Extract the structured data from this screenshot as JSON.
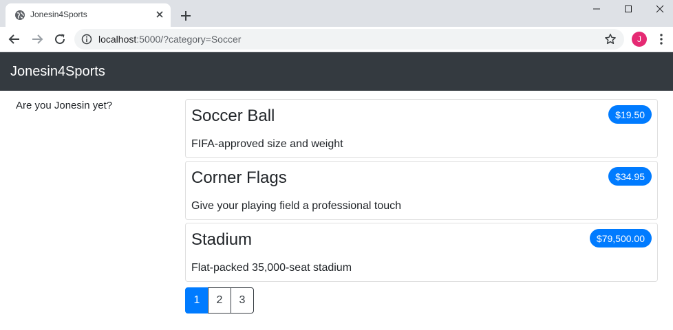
{
  "browser": {
    "tab_title": "Jonesin4Sports",
    "url_host": "localhost",
    "url_path": ":5000/?category=Soccer",
    "profile_initial": "J"
  },
  "navbar": {
    "brand": "Jonesin4Sports"
  },
  "sidebar": {
    "text": "Are you Jonesin yet?"
  },
  "products": [
    {
      "name": "Soccer Ball",
      "price": "$19.50",
      "description": "FIFA-approved size and weight"
    },
    {
      "name": "Corner Flags",
      "price": "$34.95",
      "description": "Give your playing field a professional touch"
    },
    {
      "name": "Stadium",
      "price": "$79,500.00",
      "description": "Flat-packed 35,000-seat stadium"
    }
  ],
  "pagination": {
    "pages": [
      "1",
      "2",
      "3"
    ],
    "current": "1"
  },
  "colors": {
    "navbar_bg": "#343a40",
    "accent": "#007bff",
    "profile": "#e52a73"
  }
}
